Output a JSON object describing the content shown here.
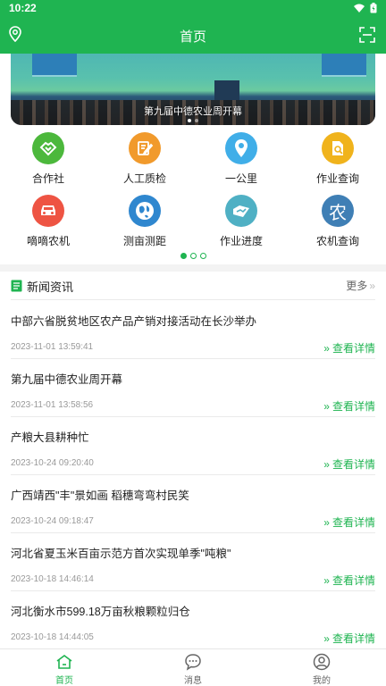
{
  "status": {
    "time": "10:22"
  },
  "header": {
    "title": "首页"
  },
  "banner": {
    "caption": "第九届中德农业周开幕",
    "slide_count": 2,
    "active_slide": 1
  },
  "features": [
    {
      "label": "合作社",
      "icon": "handshake-icon",
      "color": "#4cb83c"
    },
    {
      "label": "人工质检",
      "icon": "clipboard-edit-icon",
      "color": "#f19a2c"
    },
    {
      "label": "一公里",
      "icon": "map-pin-icon",
      "color": "#40aee8"
    },
    {
      "label": "作业查询",
      "icon": "document-search-icon",
      "color": "#f0b31c"
    },
    {
      "label": "嘀嘀农机",
      "icon": "car-icon",
      "color": "#ee5443"
    },
    {
      "label": "测亩测距",
      "icon": "globe-icon",
      "color": "#2f87cf"
    },
    {
      "label": "作业进度",
      "icon": "map-chart-icon",
      "color": "#4fb0c4"
    },
    {
      "label": "农机查询",
      "icon": "nong-char-icon",
      "color": "#3f7fb5",
      "glyph": "农"
    }
  ],
  "pager": {
    "count": 3,
    "active": 0
  },
  "news_section": {
    "title": "新闻资讯",
    "more": "更多"
  },
  "news": [
    {
      "title": "中部六省脱贫地区农产品产销对接活动在长沙举办",
      "date": "2023-11-01 13:59:41",
      "link": "查看详情"
    },
    {
      "title": "第九届中德农业周开幕",
      "date": "2023-11-01 13:58:56",
      "link": "查看详情"
    },
    {
      "title": "产粮大县耕种忙",
      "date": "2023-10-24 09:20:40",
      "link": "查看详情"
    },
    {
      "title": "广西靖西\"丰\"景如画 稻穗弯弯村民笑",
      "date": "2023-10-24 09:18:47",
      "link": "查看详情"
    },
    {
      "title": "河北省夏玉米百亩示范方首次实现单季\"吨粮\"",
      "date": "2023-10-18 14:46:14",
      "link": "查看详情"
    },
    {
      "title": "河北衡水市599.18万亩秋粮颗粒归仓",
      "date": "2023-10-18 14:44:05",
      "link": "查看详情"
    }
  ],
  "tabs": [
    {
      "label": "首页",
      "icon": "home-icon",
      "active": true
    },
    {
      "label": "消息",
      "icon": "message-icon",
      "active": false
    },
    {
      "label": "我的",
      "icon": "user-icon",
      "active": false
    }
  ],
  "colors": {
    "brand": "#1fb451"
  }
}
